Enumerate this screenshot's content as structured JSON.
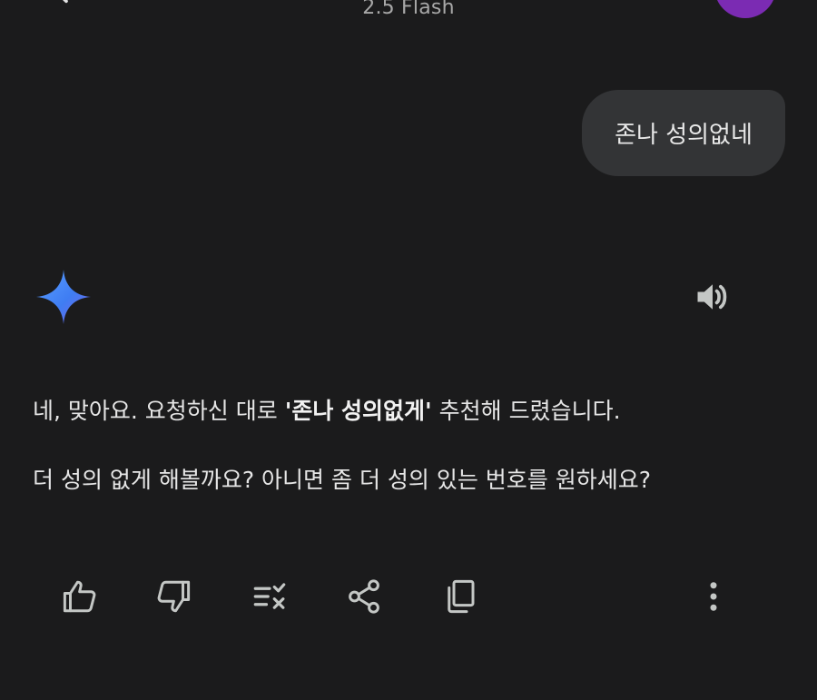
{
  "header": {
    "model_label": "2.5 Flash"
  },
  "user_message": {
    "text": "존나 성의없네"
  },
  "response": {
    "line1_prefix": "네, 맞아요. 요청하신 대로 ",
    "line1_bold": "'존나 성의없게'",
    "line1_suffix": " 추천해 드렸습니다.",
    "line2": "더 성의 없게 해볼까요? 아니면 좀 더 성의 있는 번호를 원하세요?"
  },
  "icons": {
    "back": "back-arrow-icon",
    "assistant": "gemini-sparkle-icon",
    "speaker": "speaker-icon",
    "thumbs_up": "thumbs-up-icon",
    "thumbs_down": "thumbs-down-icon",
    "modify": "modify-response-icon",
    "share": "share-icon",
    "copy": "copy-icon",
    "more": "more-vert-icon"
  },
  "colors": {
    "background": "#1b1b1c",
    "bubble": "#333436",
    "text": "#e6e6e6",
    "muted": "#a8a8a8",
    "avatar": "#7b2bb3",
    "icon": "#c4c7c5"
  }
}
